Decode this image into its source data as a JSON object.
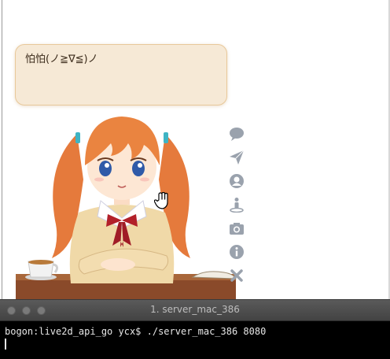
{
  "bubble": {
    "text": "怕怕(ノ≧∇≦)ノ"
  },
  "tools": [
    {
      "name": "chat",
      "icon": "comment-icon"
    },
    {
      "name": "send",
      "icon": "paper-plane-icon"
    },
    {
      "name": "user",
      "icon": "user-circle-icon"
    },
    {
      "name": "figure",
      "icon": "street-view-icon"
    },
    {
      "name": "screenshot",
      "icon": "camera-icon"
    },
    {
      "name": "info",
      "icon": "info-circle-icon"
    },
    {
      "name": "close",
      "icon": "close-icon"
    }
  ],
  "terminal": {
    "title": "1. server_mac_386",
    "prompt_line": "bogon:live2d_api_go ycx$ ./server_mac_386 8080"
  },
  "colors": {
    "bubble_bg": "#f6e9d6",
    "bubble_border": "#e8c89a",
    "tool_icon": "#9aa2ad",
    "terminal_bg": "#000000"
  }
}
